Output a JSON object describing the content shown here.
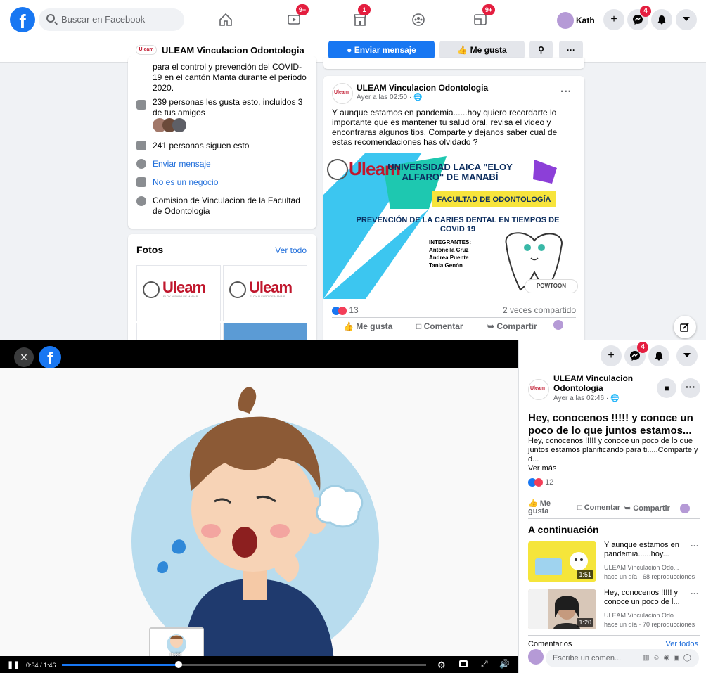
{
  "topbar": {
    "logo": "f",
    "search_placeholder": "Buscar en Facebook",
    "nav": [
      {
        "icon": "home-icon",
        "badge": ""
      },
      {
        "icon": "watch-icon",
        "badge": "9+"
      },
      {
        "icon": "marketplace-icon",
        "badge": "1"
      },
      {
        "icon": "groups-icon",
        "badge": ""
      },
      {
        "icon": "gaming-icon",
        "badge": "9+"
      }
    ],
    "profile_name": "Kath",
    "messenger_badge": "4"
  },
  "pagebar": {
    "logo_text": "Uleam",
    "title": "ULEAM Vinculacion Odontologia",
    "send_message": "Enviar mensaje",
    "like": "Me gusta",
    "more": "···"
  },
  "about": {
    "intro_text": "para el control y prevención del COVID-19 en el cantón Manta durante el periodo 2020.",
    "likes_text": "239 personas les gusta esto, incluidos 3 de tus amigos",
    "follows_text": "241 personas siguen esto",
    "message_link": "Enviar mensaje",
    "not_business": "No es un negocio",
    "info_text": "Comision de Vinculacion de la Facultad de Odontologia"
  },
  "photos": {
    "heading": "Fotos",
    "see_all": "Ver todo",
    "logo_word": "Uleam",
    "logo_sub": "ELOY ALFARO DE MANABÍ"
  },
  "post": {
    "author": "ULEAM Vinculacion Odontologia",
    "time": "Ayer a las 02:50 · ",
    "more": "···",
    "text": "Y aunque estamos en pandemia......hoy quiero recordarte lo importante que es mantener tu salud oral, revisa el video y encontraras algunos tips. Comparte y dejanos saber cual de estas recomendaciones has olvidado ?",
    "image": {
      "brand": "Uleam",
      "university": "UNIVERSIDAD LAICA \"ELOY ALFARO\" DE MANABÍ",
      "faculty": "FACULTAD DE ODONTOLOGÍA",
      "headline": "PREVENCIÓN DE LA CARIES DENTAL EN TIEMPOS DE COVID 19",
      "members_label": "INTEGRANTES:",
      "members": [
        "Antonella Cruz",
        "Andrea Puente",
        "Tania Genón"
      ],
      "powtoon": "POWTOON"
    },
    "reactions": "13",
    "shares": "2 veces compartido",
    "actions": {
      "like": "Me gusta",
      "comment": "Comentar",
      "share": "Compartir"
    }
  },
  "viewer": {
    "close": "×",
    "logo": "f",
    "time": "0:34 / 1:46",
    "progress": 0.32,
    "preview_time": "0:33"
  },
  "right_panel": {
    "messenger_badge": "4",
    "author": "ULEAM Vinculacion Odontologia",
    "time": "Ayer a las 02:46 · ",
    "title": "Hey, conocenos !!!!! y conoce un poco de lo que juntos estamos...",
    "description": "Hey, conocenos !!!!! y conoce un poco de lo que juntos estamos planificando para ti.....Comparte y d...",
    "see_more": "Ver más",
    "reactions": "12",
    "actions": {
      "like": "Me gusta",
      "comment": "Comentar",
      "share": "Compartir"
    },
    "next_heading": "A continuación",
    "next": [
      {
        "title": "Y aunque estamos en pandemia......hoy...",
        "channel": "ULEAM Vinculacion Odo...",
        "meta": "hace un día · 68 reproducciones",
        "duration": "1:51"
      },
      {
        "title": "Hey, conocenos !!!!! y conoce un poco de l...",
        "channel": "ULEAM Vinculacion Odo...",
        "meta": "hace un día · 70 reproducciones",
        "duration": "1:20"
      }
    ],
    "comments_heading": "Comentarios",
    "see_all": "Ver todos",
    "comment_placeholder": "Escribe un comen..."
  },
  "colors": {
    "brand": "#1877f2",
    "badge": "#e41e3f",
    "uleam_red": "#c0172d",
    "teal": "#1ec8b0",
    "yellow": "#f7e43c"
  }
}
